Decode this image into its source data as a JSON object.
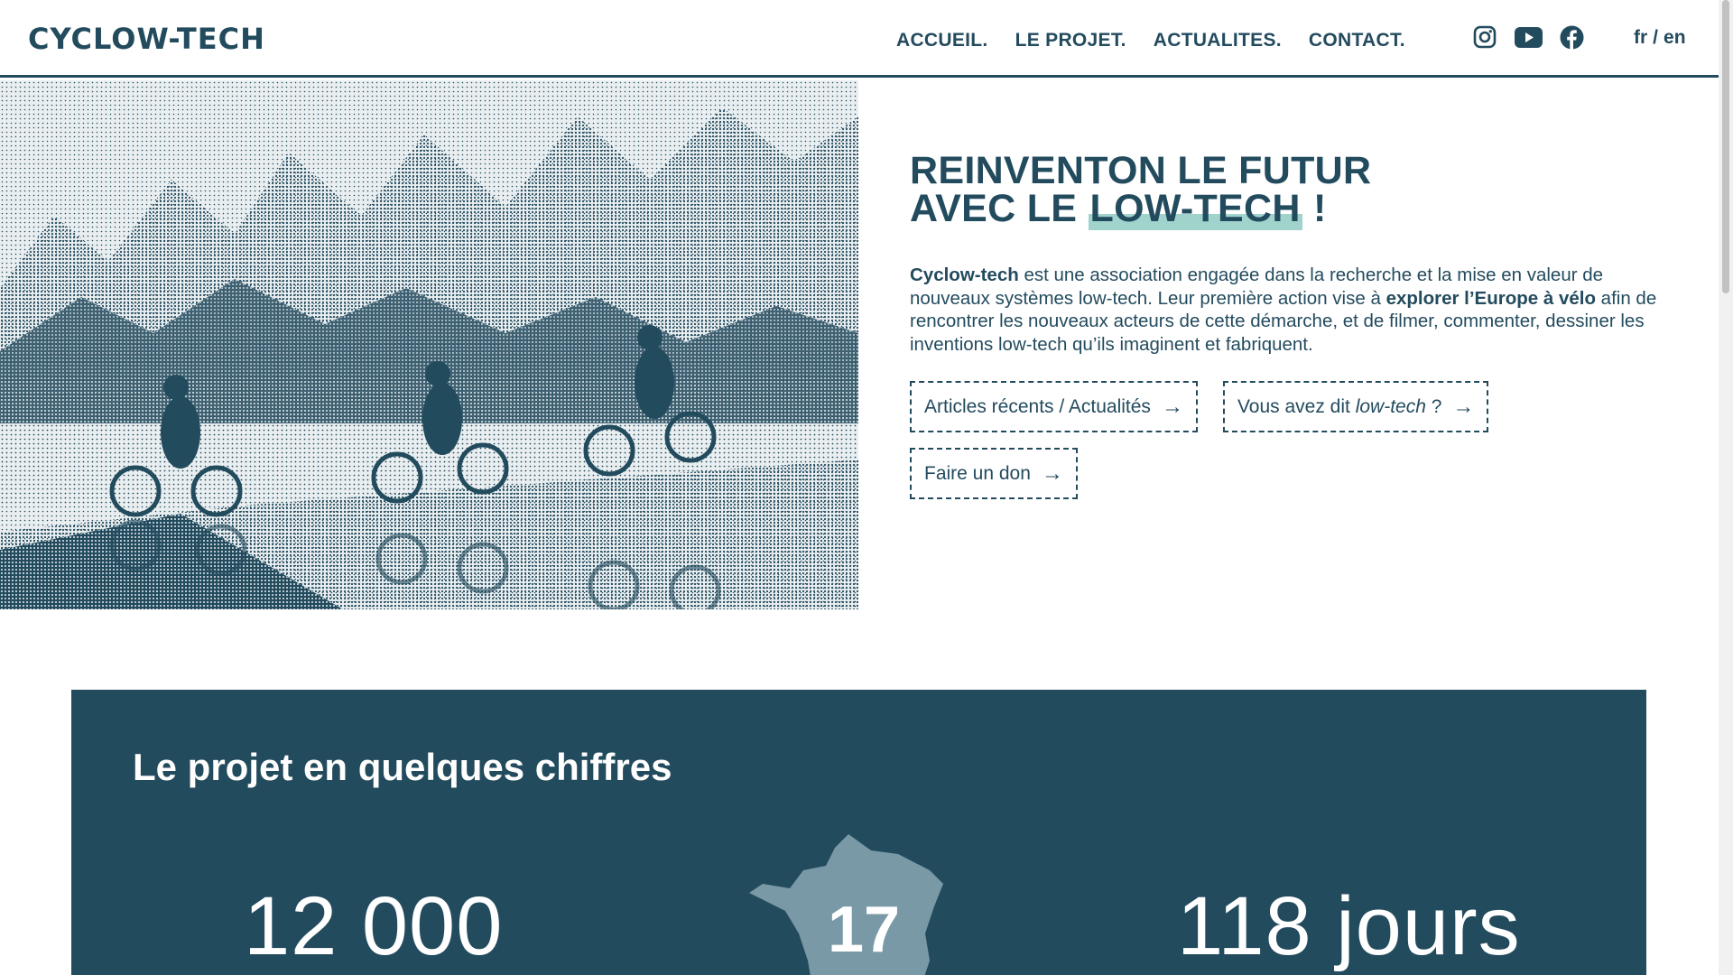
{
  "header": {
    "logo": "CYCLOW-TECH",
    "nav": [
      "ACCUEIL.",
      "LE PROJET.",
      "ACTUALITES.",
      "CONTACT."
    ],
    "socials": [
      "instagram-icon",
      "youtube-icon",
      "facebook-icon"
    ],
    "lang": {
      "fr": "fr",
      "sep": "/",
      "en": "en"
    }
  },
  "hero": {
    "title_line1": "REINVENTON LE FUTUR",
    "title_line2_pre": "AVEC LE ",
    "title_highlight": "LOW-TECH",
    "title_line2_post": " !",
    "desc_brand": "Cyclow-tech",
    "desc_part1": " est une association engagée dans la recherche et la mise en valeur de nouveaux systèmes low-tech. Leur première action vise à ",
    "desc_bold2": "explorer l’Europe à vélo",
    "desc_part2": " afin de rencontrer les nouveaux acteurs de cette démarche, et de filmer, commenter, dessiner les inventions low-tech qu’ils imaginent et fabriquent.",
    "buttons": {
      "articles": "Articles récents / Actualités",
      "lowtech_pre": "Vous avez dit ",
      "lowtech_em": "low-tech",
      "lowtech_post": " ?",
      "donate": "Faire un don",
      "arrow": "→"
    }
  },
  "stats": {
    "title": "Le projet en quelques chiffres",
    "km": "12 000",
    "regions": "17",
    "days": "118 jours"
  },
  "colors": {
    "primary": "#234b5e",
    "highlight": "#9fd3cc",
    "france_fill": "#7a99a6"
  }
}
